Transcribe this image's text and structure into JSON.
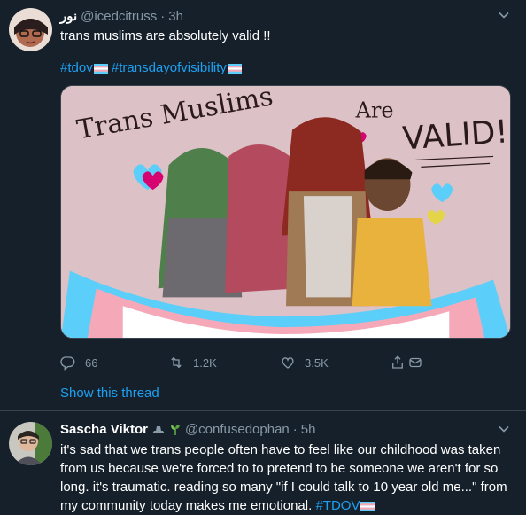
{
  "tweet1": {
    "display_name": "نور",
    "handle": "@icedcitruss",
    "dot": "·",
    "time": "3h",
    "text_line1": "trans muslims are absolutely valid !!",
    "hashtag1": "#tdov",
    "hashtag2": "#transdayofvisibility",
    "image_text": {
      "left": "Trans Muslims",
      "are": "Are",
      "valid": "VALID!"
    },
    "reply_count": "66",
    "retweet_count": "1.2K",
    "like_count": "3.5K",
    "show_thread": "Show this thread"
  },
  "tweet2": {
    "display_name": "Sascha Viktor",
    "handle": "@confusedophan",
    "dot": "·",
    "time": "5h",
    "text_lines": [
      "it's sad that we trans people often have to feel like our childhood was taken",
      "from us because we're forced to to pretend to be someone we aren't for so",
      "long. it's traumatic. reading so many \"if I could talk to 10 year old me...\" from",
      "my community today makes me emotional."
    ],
    "hashtag": "#TDOV"
  },
  "colors": {
    "background": "#15202b",
    "divider": "#38444d",
    "text": "#ffffff",
    "muted": "#8899a6",
    "link": "#1da1f2"
  },
  "icons": {
    "caret": "chevron-down-icon",
    "reply": "reply-icon",
    "retweet": "retweet-icon",
    "like": "heart-icon",
    "share": "share-icon",
    "flag": "trans-flag-icon"
  }
}
